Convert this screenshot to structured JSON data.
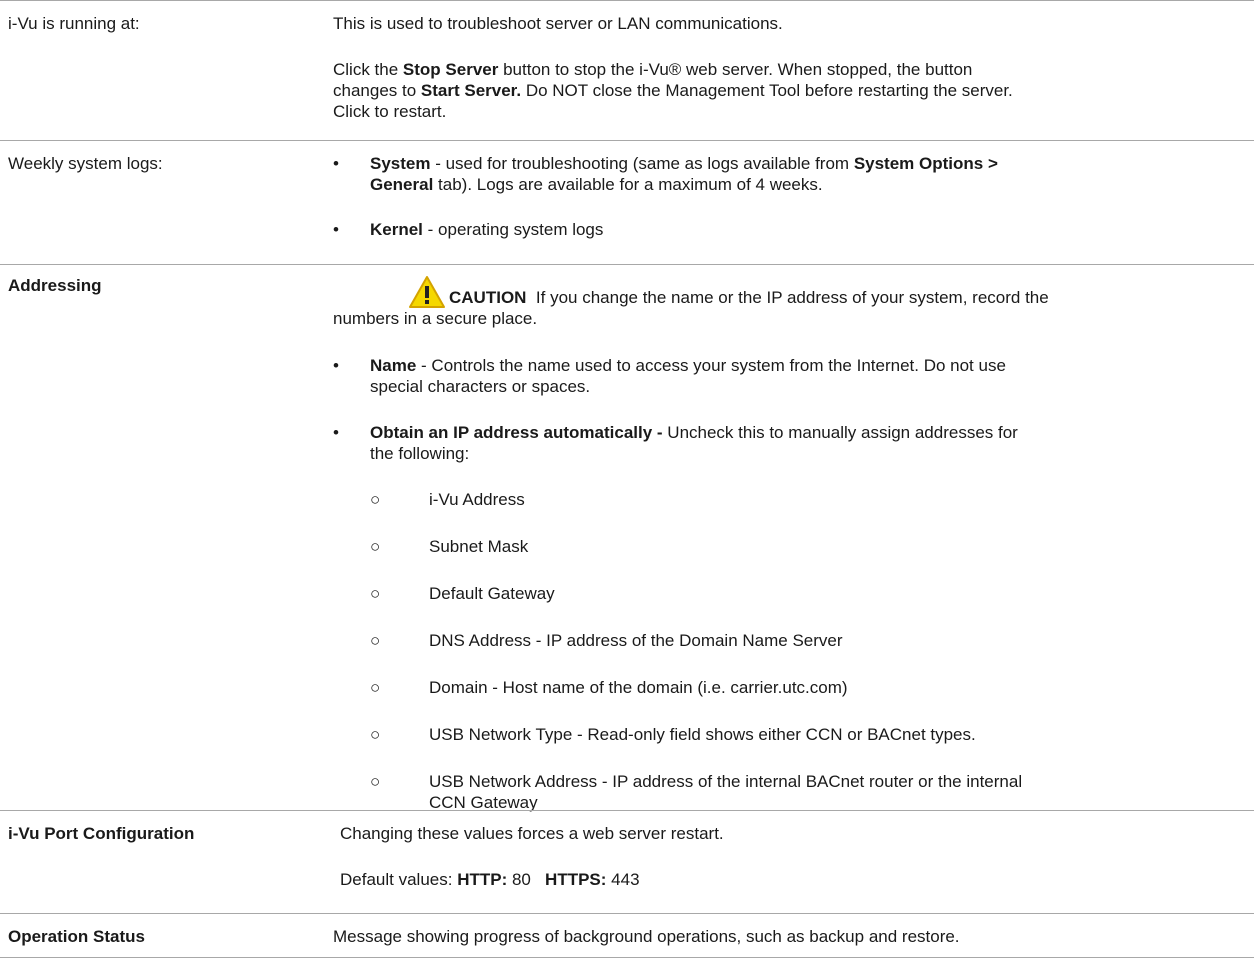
{
  "rows": {
    "running": {
      "label": "i-Vu is running at:",
      "p1": "This is used to troubleshoot server or LAN communications.",
      "p2_a": "Click the ",
      "p2_b": "Stop Server",
      "p2_c": " button to stop the i-Vu® web server. When stopped, the button",
      "p2_d": "changes to ",
      "p2_e": "Start Server.",
      "p2_f": " Do NOT close the Management Tool before restarting the server.",
      "p2_g": "Click to restart."
    },
    "logs": {
      "label": "Weekly system logs:",
      "bullet": "•",
      "system_term": "System",
      "system_a": " - used for troubleshooting (same as logs available from ",
      "system_b": "System Options >",
      "system_c": "General",
      "system_d": " tab). Logs are available for a maximum of 4 weeks.",
      "kernel_term": "Kernel",
      "kernel_desc": " - operating system logs"
    },
    "addressing": {
      "label": "Addressing",
      "caution_word": "CAUTION",
      "caution_a": "  If you change the name or the IP address of your system, record the",
      "caution_b": "numbers in a secure place.",
      "bullet": "•",
      "name_term": "Name",
      "name_a": " - Controls the name used to access your system from the Internet. Do not use",
      "name_b": "special characters or spaces.",
      "obtain_term": "Obtain an IP address automatically -",
      "obtain_a": " Uncheck this to manually assign addresses for",
      "obtain_b": "the following:",
      "sub_bullet": "○",
      "sub_items": [
        "i-Vu Address",
        "Subnet Mask",
        "Default Gateway",
        "DNS Address - IP address of the Domain Name Server",
        "Domain - Host name of the domain (i.e. carrier.utc.com)",
        "USB Network Type - Read-only field shows either CCN or BACnet types.",
        "USB Network Address - IP address of the internal BACnet router or the internal"
      ],
      "sub_item_7_cont": "CCN Gateway"
    },
    "port": {
      "label": "i-Vu Port Configuration",
      "p1": "Changing these values forces a web server restart.",
      "p2_a": "Default values: ",
      "http_label": "HTTP:",
      "http_value": " 80   ",
      "https_label": "HTTPS:",
      "https_value": " 443"
    },
    "status": {
      "label": "Operation Status",
      "p1": "Message showing progress of background operations, such as backup and restore."
    }
  },
  "colors": {
    "rule": "#a8a8a8",
    "caution_fill": "#f5d800",
    "caution_stroke": "#d4a300"
  },
  "icons": {
    "caution": "warning-triangle-icon"
  }
}
